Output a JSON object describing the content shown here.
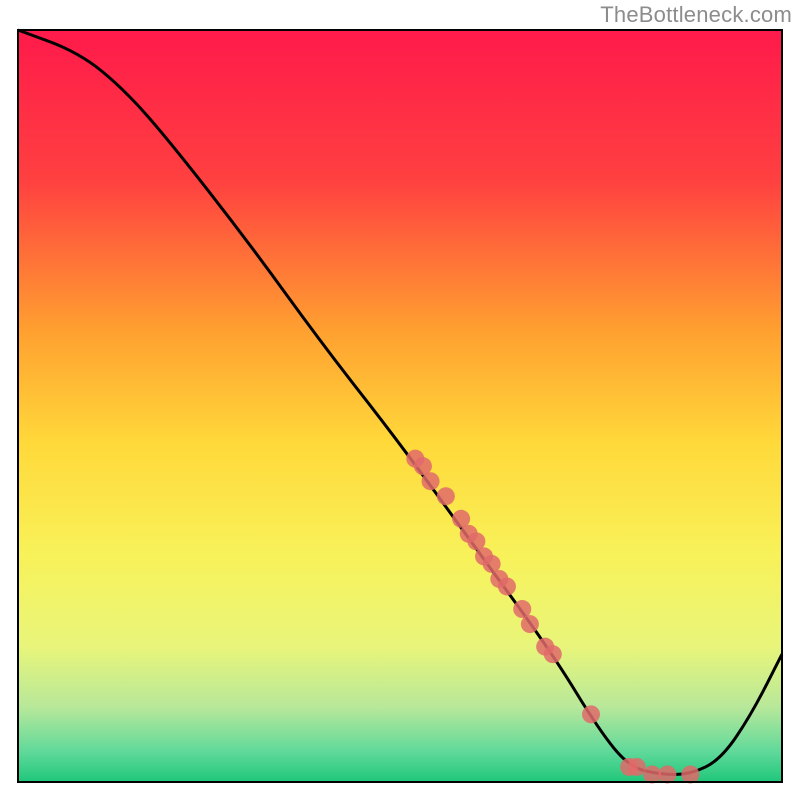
{
  "attribution": "TheBottleneck.com",
  "chart_data": {
    "type": "line",
    "title": "",
    "xlabel": "",
    "ylabel": "",
    "xlim": [
      0,
      100
    ],
    "ylim": [
      0,
      100
    ],
    "gradient_stops": [
      {
        "offset": 0.0,
        "color": "#ff1a4b"
      },
      {
        "offset": 0.2,
        "color": "#ff4040"
      },
      {
        "offset": 0.4,
        "color": "#ffa030"
      },
      {
        "offset": 0.55,
        "color": "#ffd93a"
      },
      {
        "offset": 0.7,
        "color": "#f8f25a"
      },
      {
        "offset": 0.82,
        "color": "#e8f57a"
      },
      {
        "offset": 0.9,
        "color": "#b8e89a"
      },
      {
        "offset": 0.96,
        "color": "#5fd99a"
      },
      {
        "offset": 1.0,
        "color": "#1fc77a"
      }
    ],
    "curve": [
      {
        "x": 0,
        "y": 100
      },
      {
        "x": 8,
        "y": 97
      },
      {
        "x": 14,
        "y": 92
      },
      {
        "x": 20,
        "y": 85
      },
      {
        "x": 30,
        "y": 72
      },
      {
        "x": 40,
        "y": 58
      },
      {
        "x": 50,
        "y": 45
      },
      {
        "x": 60,
        "y": 31
      },
      {
        "x": 70,
        "y": 17
      },
      {
        "x": 76,
        "y": 7
      },
      {
        "x": 80,
        "y": 2
      },
      {
        "x": 84,
        "y": 1
      },
      {
        "x": 88,
        "y": 1
      },
      {
        "x": 92,
        "y": 3
      },
      {
        "x": 96,
        "y": 9
      },
      {
        "x": 100,
        "y": 17
      }
    ],
    "data_points": [
      {
        "x": 52,
        "y": 43
      },
      {
        "x": 53,
        "y": 42
      },
      {
        "x": 54,
        "y": 40
      },
      {
        "x": 56,
        "y": 38
      },
      {
        "x": 58,
        "y": 35
      },
      {
        "x": 59,
        "y": 33
      },
      {
        "x": 60,
        "y": 32
      },
      {
        "x": 61,
        "y": 30
      },
      {
        "x": 62,
        "y": 29
      },
      {
        "x": 63,
        "y": 27
      },
      {
        "x": 64,
        "y": 26
      },
      {
        "x": 66,
        "y": 23
      },
      {
        "x": 67,
        "y": 21
      },
      {
        "x": 69,
        "y": 18
      },
      {
        "x": 70,
        "y": 17
      },
      {
        "x": 75,
        "y": 9
      },
      {
        "x": 80,
        "y": 2
      },
      {
        "x": 81,
        "y": 2
      },
      {
        "x": 83,
        "y": 1
      },
      {
        "x": 85,
        "y": 1
      },
      {
        "x": 88,
        "y": 1
      }
    ],
    "point_color": "#e06a6a",
    "curve_color": "#000000"
  }
}
